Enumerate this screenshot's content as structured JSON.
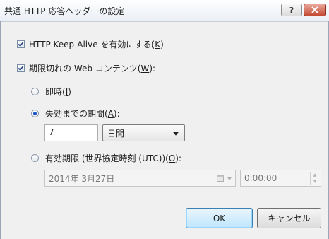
{
  "window": {
    "title": "共通 HTTP 応答ヘッダーの設定"
  },
  "options": {
    "keep_alive": {
      "label": "HTTP Keep-Alive を有効にする(",
      "key": "K",
      "checked": true
    },
    "expire_content": {
      "label": "期限切れの Web コンテンツ(",
      "key": "W",
      "suffix": "):",
      "checked": true
    },
    "immediately": {
      "label": "即時(",
      "key": "I",
      "suffix": ")"
    },
    "after": {
      "label": "失効までの期間(",
      "key": "A",
      "suffix": "):",
      "selected": true
    },
    "on": {
      "label": "有効期限 (世界協定時刻 (UTC))(",
      "key": "O",
      "suffix": "):"
    }
  },
  "after_value": "7",
  "after_unit": "日間",
  "date_value": "2014年  3月27日",
  "time_value": "0:00:00",
  "buttons": {
    "ok": "OK",
    "cancel": "キャンセル"
  }
}
